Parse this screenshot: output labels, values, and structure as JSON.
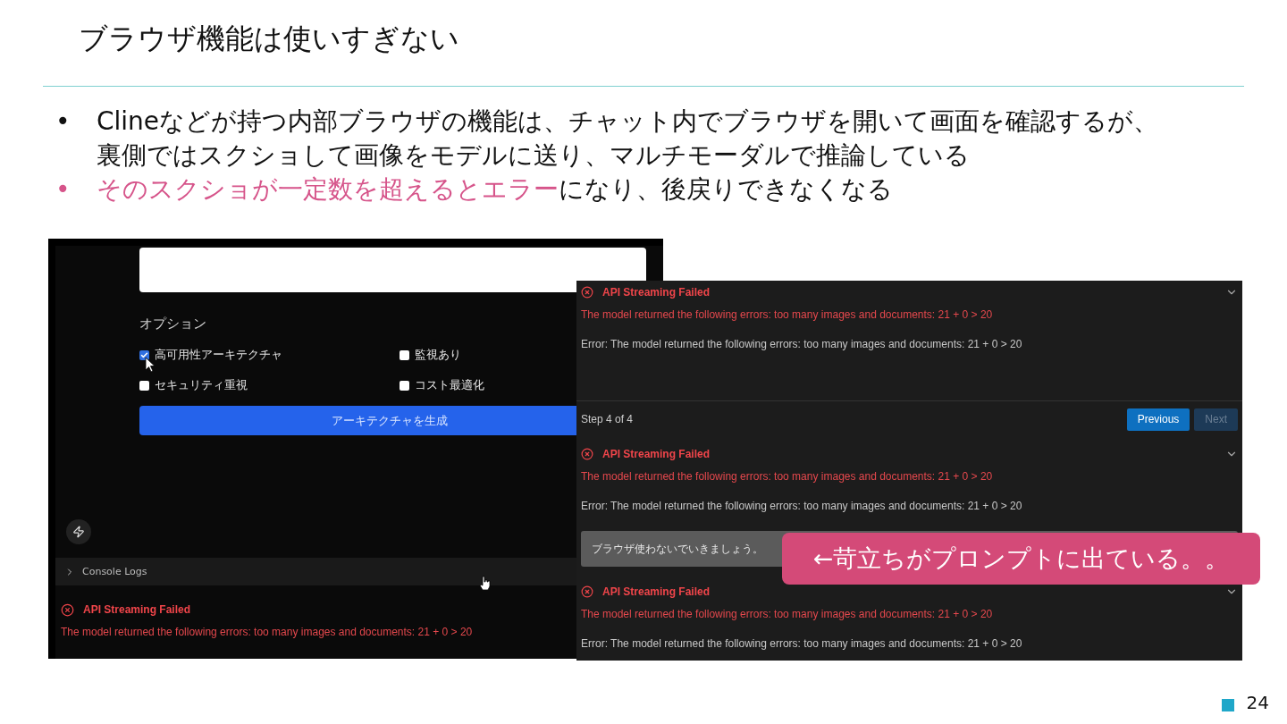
{
  "slide": {
    "title": "ブラウザ機能は使いすぎない",
    "bullets": [
      {
        "marker": "•",
        "parts": [
          {
            "text": "Clineなどが持つ内部ブラウザの機能は、チャット内でブラウザを開いて画面を確認するが、裏側ではスクショして画像をモデルに送り、マルチモーダルで推論している",
            "accent": false
          }
        ]
      },
      {
        "marker": "•",
        "parts": [
          {
            "text": "そのスクショが一定数を超えるとエラー",
            "accent": true
          },
          {
            "text": "になり、後戻りできなくなる",
            "accent": false
          }
        ]
      }
    ],
    "page_number": "24"
  },
  "left_screenshot": {
    "options_label": "オプション",
    "options": [
      {
        "label": "高可用性アーキテクチャ",
        "checked": true
      },
      {
        "label": "監視あり",
        "checked": false
      },
      {
        "label": "セキュリティ重視",
        "checked": false
      },
      {
        "label": "コスト最適化",
        "checked": false
      }
    ],
    "generate_button": "アーキテクチャを生成",
    "console_logs": "Console Logs",
    "error": {
      "title": "API Streaming Failed",
      "message": "The model returned the following errors: too many images and documents: 21 + 0 > 20"
    }
  },
  "right_screenshot": {
    "blocks": [
      {
        "kind": "error",
        "title": "API Streaming Failed",
        "message": "The model returned the following errors: too many images and documents: 21 + 0 > 20",
        "detail": "Error: The model returned the following errors: too many images and documents: 21 + 0 > 20"
      },
      {
        "kind": "stepper",
        "step": "Step 4 of 4",
        "buttons": [
          {
            "label": "Previous",
            "disabled": false
          },
          {
            "label": "Next",
            "disabled": true
          }
        ]
      },
      {
        "kind": "error",
        "title": "API Streaming Failed",
        "message": "The model returned the following errors: too many images and documents: 21 + 0 > 20",
        "detail": "Error: The model returned the following errors: too many images and documents: 21 + 0 > 20"
      },
      {
        "kind": "prompt",
        "text": "ブラウザ使わないでいきましょう。"
      },
      {
        "kind": "error",
        "title": "API Streaming Failed",
        "message": "The model returned the following errors: too many images and documents: 21 + 0 > 20",
        "detail": "Error: The model returned the following errors: too many images and documents: 21 + 0 > 20"
      }
    ]
  },
  "callout": "←苛立ちがプロンプトに出ている。。"
}
